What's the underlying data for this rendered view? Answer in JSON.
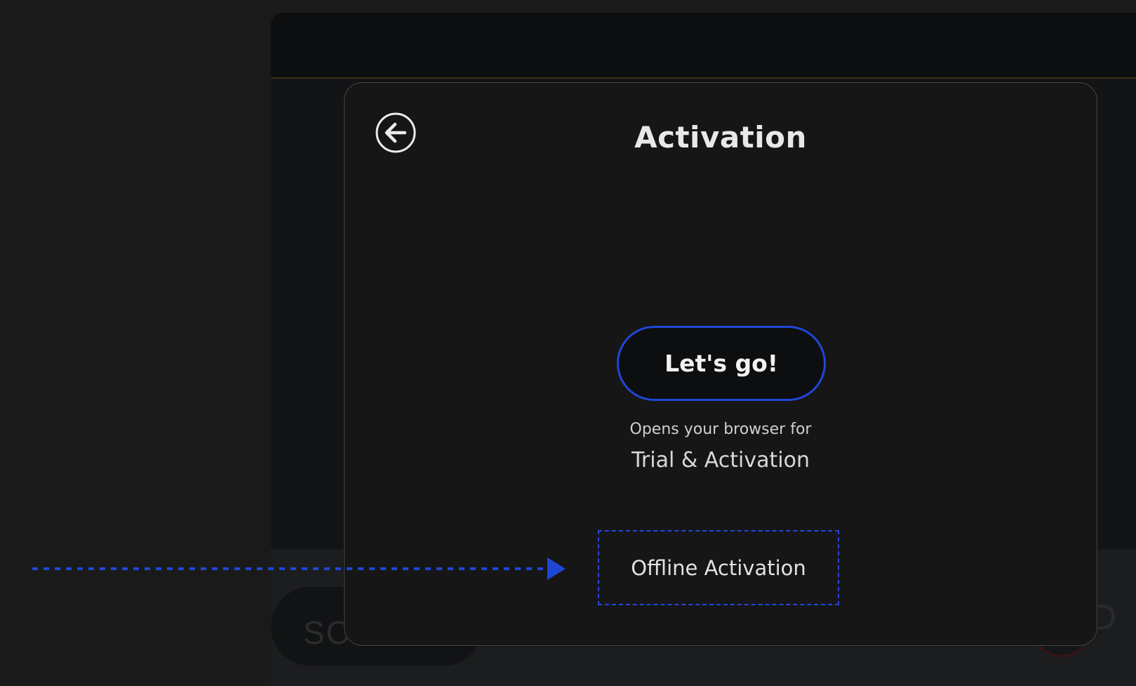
{
  "dialog": {
    "title": "Activation",
    "back_icon": "back-arrow-circle-icon",
    "primary_button_label": "Let's go!",
    "helper_line_1": "Opens your browser for",
    "helper_line_2": "Trial & Activation",
    "offline_button_label": "Offline Activation"
  },
  "background": {
    "left_pill_text": "SC",
    "right_pill_text": "D"
  },
  "annotation": {
    "icon": "dashed-arrow-right-icon"
  },
  "colors": {
    "accent_blue": "#1f47d6",
    "dialog_background": "#161617",
    "page_background": "#1a1a1b",
    "text_primary": "#e8e8e8"
  }
}
